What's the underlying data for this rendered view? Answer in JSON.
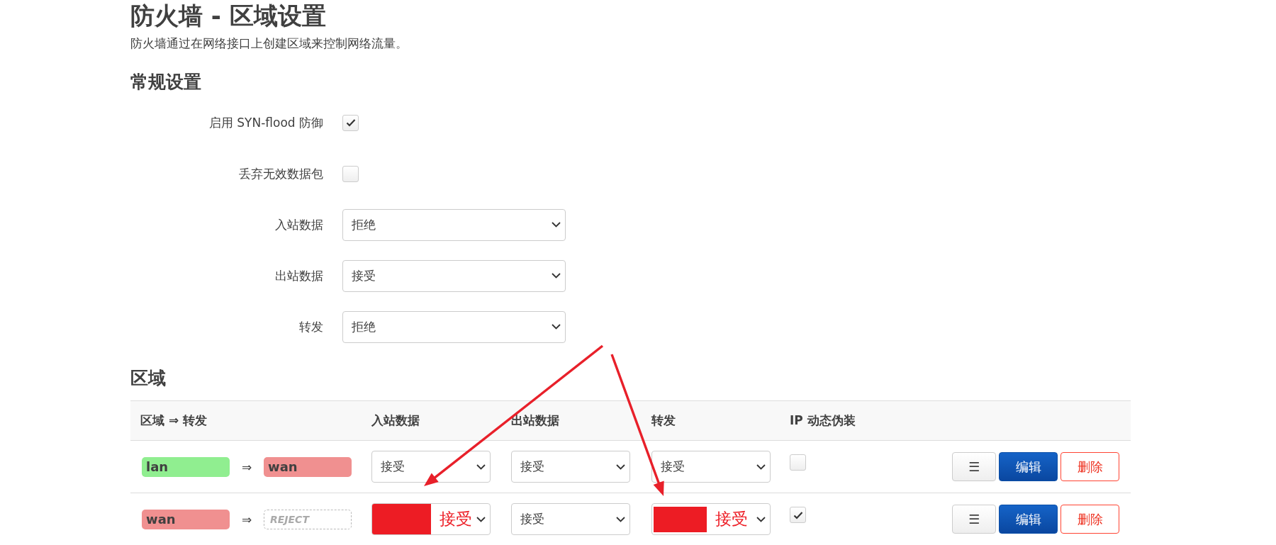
{
  "page": {
    "title": "防火墙 - 区域设置",
    "description": "防火墙通过在网络接口上创建区域来控制网络流量。"
  },
  "general": {
    "heading": "常规设置",
    "fields": [
      {
        "kind": "checkbox",
        "label": "启用 SYN-flood 防御",
        "checked": true
      },
      {
        "kind": "checkbox",
        "label": "丢弃无效数据包",
        "checked": false
      },
      {
        "kind": "select",
        "label": "入站数据",
        "value": "拒绝"
      },
      {
        "kind": "select",
        "label": "出站数据",
        "value": "接受"
      },
      {
        "kind": "select",
        "label": "转发",
        "value": "拒绝"
      }
    ]
  },
  "zones": {
    "heading": "区域",
    "columns": [
      "区域 ⇒ 转发",
      "入站数据",
      "出站数据",
      "转发",
      "IP 动态伪装"
    ],
    "rows": [
      {
        "zone": {
          "name": "lan",
          "color": "#90ee90"
        },
        "arrow": "⇒",
        "forward": {
          "kind": "zone",
          "name": "wan",
          "color": "#f09090"
        },
        "input": {
          "value": "接受",
          "redacted": false
        },
        "output": {
          "value": "接受",
          "redacted": false
        },
        "forwarding": {
          "value": "接受",
          "redacted": false
        },
        "masquerade": false,
        "actions": [
          {
            "kind": "menu",
            "label": "☰"
          },
          {
            "kind": "edit",
            "label": "编辑"
          },
          {
            "kind": "delete",
            "label": "删除"
          }
        ]
      },
      {
        "zone": {
          "name": "wan",
          "color": "#f09090"
        },
        "arrow": "⇒",
        "forward": {
          "kind": "policy",
          "name": "REJECT"
        },
        "input": {
          "value": "接受",
          "redacted": true
        },
        "output": {
          "value": "接受",
          "redacted": false
        },
        "forwarding": {
          "value": "接受",
          "redacted": true
        },
        "masquerade": true,
        "actions": [
          {
            "kind": "menu",
            "label": "☰"
          },
          {
            "kind": "edit",
            "label": "编辑"
          },
          {
            "kind": "delete",
            "label": "删除"
          }
        ]
      }
    ]
  },
  "annotations": [
    {
      "kind": "arrow"
    },
    {
      "kind": "arrow"
    }
  ]
}
